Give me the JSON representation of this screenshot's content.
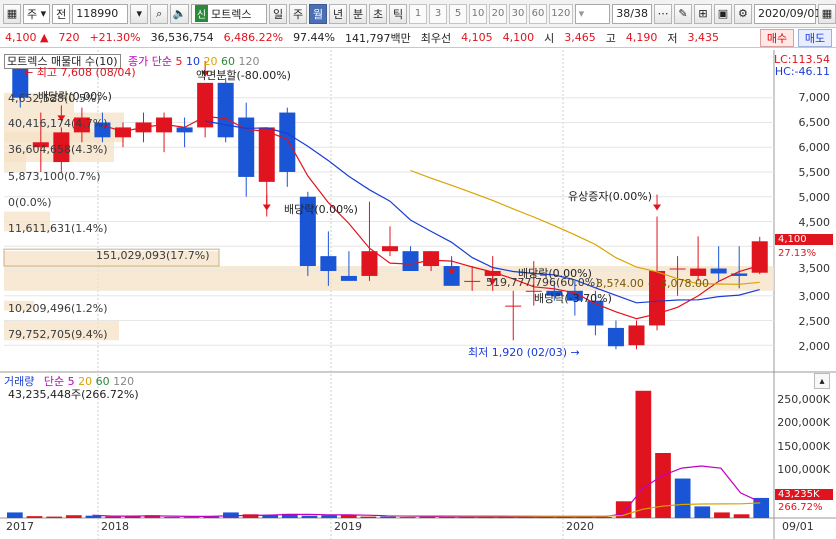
{
  "toolbar": {
    "type_label": "주",
    "market_label": "전",
    "code": "118990",
    "badge": "신",
    "name": "모트렉스",
    "periods": [
      "일",
      "주",
      "월",
      "년",
      "분",
      "초",
      "틱"
    ],
    "active_period": "월",
    "numbers": [
      "1",
      "3",
      "5",
      "10",
      "20",
      "30",
      "60",
      "120"
    ],
    "page_count": "38/38",
    "date": "2020/09/01"
  },
  "quote": {
    "price": "4,100",
    "arrow": "▲",
    "change": "720",
    "change_pct": "+21.30%",
    "volume": "36,536,754",
    "volume_pct": "6,486.22%",
    "ratio": "97.44%",
    "amount": "141,797백만",
    "best_label": "최우선",
    "best_sell": "4,105",
    "best_buy": "4,100",
    "open_label": "시",
    "open": "3,465",
    "high_label": "고",
    "high": "4,190",
    "low_label": "저",
    "low": "3,435",
    "buy_btn": "매수",
    "sell_btn": "매도"
  },
  "price_panel": {
    "title": "모트렉스 매물대 수(10)",
    "ma_label": "종가 단순",
    "ma_periods": [
      "5",
      "10",
      "20",
      "60",
      "120"
    ],
    "ma_colors": [
      "#e0141e",
      "#1a3cd6",
      "#d9a400",
      "#2a8a3a",
      "#888888"
    ],
    "lc": "LC:113.54",
    "hc": "HC:-46.11",
    "high_mark": "최고 7,608 (08/04)",
    "low_mark": "최저 1,920 (02/03)",
    "annotations": [
      "배당락(0.00%)",
      "액면분할(-80.00%)",
      "배당락(0.00%)",
      "유상증자(0.00%)",
      "배당락(0.00%)",
      "배당락(-3.70%)"
    ],
    "range_text": "3,5?4.00 ~ 3,078.00",
    "volume_profile": [
      "4,652,528(0.5%)",
      "40,416,174(4.7%)",
      "36,604,658(4.3%)",
      "5,873,100(0.7%)",
      "0(0.0%)",
      "11,611,631(1.4%)",
      "151,029,093(17.7%)",
      "519,777,796(60.0%)",
      "10,209,496(1.2%)",
      "79,752,705(9.4%)"
    ],
    "y_ticks": [
      "7,000",
      "6,500",
      "6,000",
      "5,500",
      "5,000",
      "4,500",
      "4,000",
      "3,500",
      "3,000",
      "2,500",
      "2,000"
    ],
    "price_tag": "4,100",
    "price_tag_pct": "27.13%"
  },
  "volume_panel": {
    "title": "거래량",
    "ma_label": "단순",
    "ma_periods": [
      "5",
      "20",
      "60",
      "120"
    ],
    "summary": "43,235,448주(266.72%)",
    "y_ticks": [
      "250,000K",
      "200,000K",
      "150,000K",
      "100,000K",
      "50,000K"
    ],
    "vol_tag": "43,235K",
    "vol_tag_pct": "266.72%"
  },
  "x_axis": [
    "2017",
    "2018",
    "2019",
    "2020",
    "09/01"
  ],
  "chart_data": {
    "type": "candlestick",
    "interval": "monthly",
    "ohlc": [
      [
        7600,
        7608,
        6800,
        7000
      ],
      [
        6000,
        6700,
        5500,
        6100
      ],
      [
        5700,
        6400,
        5500,
        6300
      ],
      [
        6300,
        6800,
        6100,
        6600
      ],
      [
        6500,
        6700,
        6100,
        6200
      ],
      [
        6200,
        6500,
        6000,
        6400
      ],
      [
        6300,
        6700,
        6100,
        6500
      ],
      [
        6300,
        6700,
        5900,
        6600
      ],
      [
        6400,
        6600,
        6000,
        6300
      ],
      [
        6400,
        7100,
        6200,
        7300
      ],
      [
        7300,
        7400,
        6100,
        6200
      ],
      [
        6600,
        6900,
        5000,
        5400
      ],
      [
        5300,
        6300,
        4600,
        6400
      ],
      [
        6700,
        6800,
        5200,
        5500
      ],
      [
        5000,
        5100,
        3400,
        3600
      ],
      [
        3800,
        4300,
        3200,
        3500
      ],
      [
        3400,
        3900,
        3300,
        3300
      ],
      [
        3400,
        4900,
        3300,
        3900
      ],
      [
        3900,
        4400,
        3800,
        4000
      ],
      [
        3900,
        4000,
        3500,
        3500
      ],
      [
        3600,
        3900,
        3500,
        3900
      ],
      [
        3600,
        3800,
        3200,
        3200
      ],
      [
        3300,
        3600,
        3100,
        3300
      ],
      [
        3400,
        3800,
        3100,
        3500
      ],
      [
        2800,
        3100,
        2100,
        2800
      ],
      [
        3100,
        3700,
        2800,
        3100
      ],
      [
        3100,
        3300,
        2900,
        3000
      ],
      [
        3100,
        3300,
        2600,
        2900
      ],
      [
        2900,
        3100,
        2200,
        2400
      ],
      [
        2350,
        2500,
        1920,
        1980
      ],
      [
        2000,
        2500,
        1920,
        2400
      ],
      [
        2400,
        4600,
        2300,
        3500
      ],
      [
        3550,
        3800,
        3000,
        3550
      ],
      [
        3400,
        4200,
        3300,
        3550
      ],
      [
        3550,
        4000,
        3300,
        3450
      ],
      [
        3450,
        4000,
        3150,
        3400
      ],
      [
        3465,
        4190,
        3435,
        4100
      ]
    ],
    "volumes_k": [
      12000,
      4000,
      3000,
      6000,
      5000,
      3000,
      4000,
      6000,
      2000,
      2000,
      3000,
      12000,
      8000,
      6000,
      9000,
      5000,
      6000,
      7000,
      3000,
      3000,
      2000,
      3000,
      2000,
      2000,
      2000,
      2000,
      2000,
      2000,
      3000,
      2000,
      2000,
      36000,
      274000,
      140000,
      85000,
      25000,
      12000,
      8000,
      43235
    ],
    "ylim": [
      1500,
      7600
    ],
    "vol_ylim": [
      0,
      280000
    ]
  }
}
